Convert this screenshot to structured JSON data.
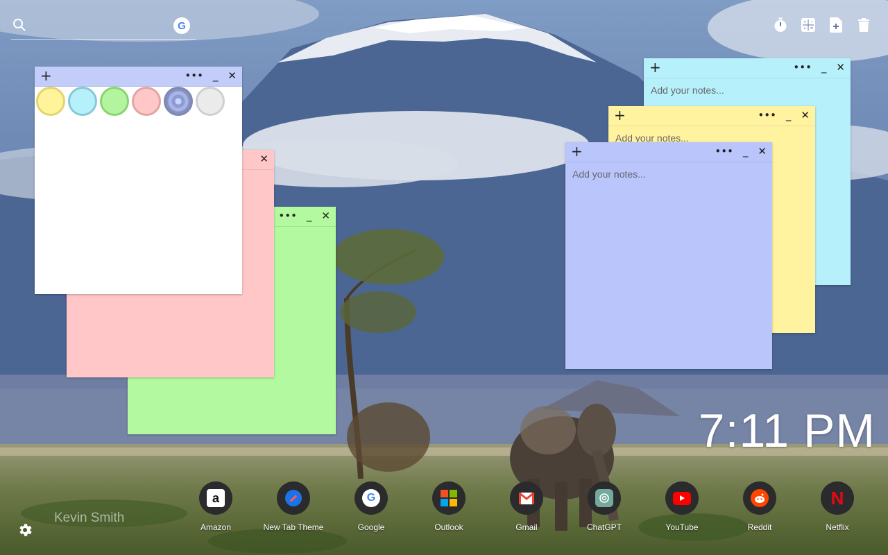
{
  "search": {
    "placeholder": "",
    "engine_icon": "google-g-icon",
    "engine_letter": "G"
  },
  "tools": [
    {
      "name": "timer-icon"
    },
    {
      "name": "calculator-icon"
    },
    {
      "name": "add-note-file-icon"
    },
    {
      "name": "trash-icon"
    }
  ],
  "palette": {
    "colors": [
      "#fff39c",
      "#b6f0fb",
      "#b3f59f",
      "#ffc7c7",
      "#b9c5f7",
      "#ebebeb"
    ],
    "selected_index": 4
  },
  "notes": {
    "white": {
      "color": "#ffffff",
      "bar_color": "#c3cdfa"
    },
    "pink": {
      "color": "#ffc7c7"
    },
    "green": {
      "color": "#b3f99f"
    },
    "cyan": {
      "color": "#b6f0fb",
      "placeholder": "Add your notes..."
    },
    "yellow": {
      "color": "#fff3a0",
      "placeholder": "Add your notes..."
    },
    "blue": {
      "color": "#b9c5fb",
      "placeholder": "Add your notes..."
    }
  },
  "note_controls": {
    "add": "+",
    "more": "•••",
    "minimize": "_",
    "close": "✕"
  },
  "clock": {
    "time": "7:11 PM"
  },
  "user": {
    "name": "Kevin Smith"
  },
  "shortcuts": [
    {
      "label": "Amazon",
      "icon": "amazon-icon"
    },
    {
      "label": "New Tab Theme",
      "icon": "new-tab-theme-icon"
    },
    {
      "label": "Google",
      "icon": "google-icon"
    },
    {
      "label": "Outlook",
      "icon": "outlook-icon"
    },
    {
      "label": "Gmail",
      "icon": "gmail-icon"
    },
    {
      "label": "ChatGPT",
      "icon": "chatgpt-icon"
    },
    {
      "label": "YouTube",
      "icon": "youtube-icon"
    },
    {
      "label": "Reddit",
      "icon": "reddit-icon"
    },
    {
      "label": "Netflix",
      "icon": "netflix-icon"
    }
  ]
}
